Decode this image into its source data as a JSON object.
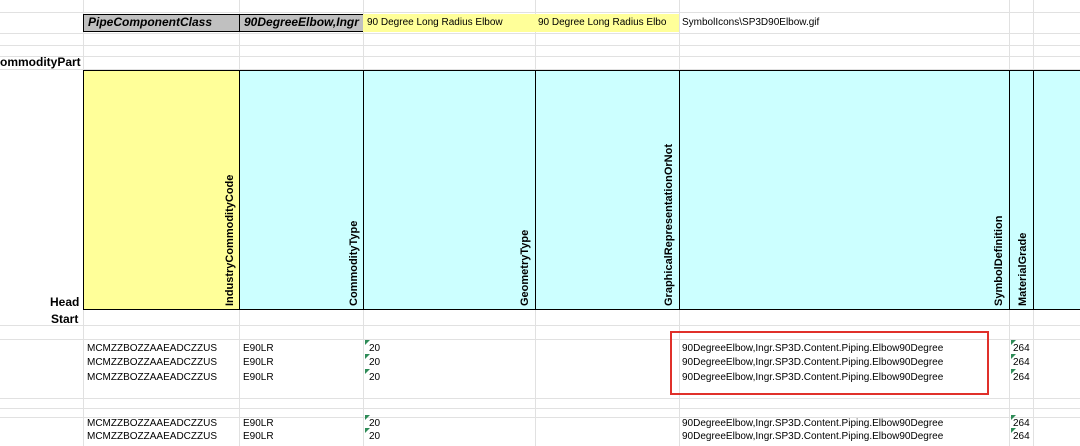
{
  "class_row": {
    "class_label": "PipeComponentClass",
    "class_value": "90DegreeElbow,Ingr",
    "desc_1": "90 Degree Long Radius Elbow",
    "desc_2": "90 Degree Long Radius Elbo",
    "icon_path": "SymbolIcons\\SP3D90Elbow.gif"
  },
  "section_label": "ommodityPart",
  "row_labels": {
    "head": "Head",
    "start": "Start"
  },
  "columns": [
    "IndustryCommodityCode",
    "CommodityType",
    "GeometryType",
    "GraphicalRepresentationOrNot",
    "SymbolDefinition",
    "MaterialGrade"
  ],
  "rows": [
    {
      "code": "MCMZZBOZZAAEADCZZUS",
      "type": "E90LR",
      "graph": "20",
      "symbol": "90DegreeElbow,Ingr.SP3D.Content.Piping.Elbow90Degree",
      "grade": "264"
    },
    {
      "code": "MCMZZBOZZAAEADCZZUS",
      "type": "E90LR",
      "graph": "20",
      "symbol": "90DegreeElbow,Ingr.SP3D.Content.Piping.Elbow90Degree",
      "grade": "264"
    },
    {
      "code": "MCMZZBOZZAAEADCZZUS",
      "type": "E90LR",
      "graph": "20",
      "symbol": "90DegreeElbow,Ingr.SP3D.Content.Piping.Elbow90Degree",
      "grade": "264"
    },
    {
      "code": "MCMZZBOZZAAEADCZZUS",
      "type": "E90LR",
      "graph": "20",
      "symbol": "90DegreeElbow,Ingr.SP3D.Content.Piping.Elbow90Degree",
      "grade": "264"
    },
    {
      "code": "MCMZZBOZZAAEADCZZUS",
      "type": "E90LR",
      "graph": "20",
      "symbol": "90DegreeElbow,Ingr.SP3D.Content.Piping.Elbow90Degree",
      "grade": "264"
    }
  ],
  "colors": {
    "yellow": "#ffff99",
    "cyan": "#ccffff",
    "grey": "#c0c0c0",
    "highlight": "#e0302a",
    "comment_marker": "#2e8b57"
  }
}
